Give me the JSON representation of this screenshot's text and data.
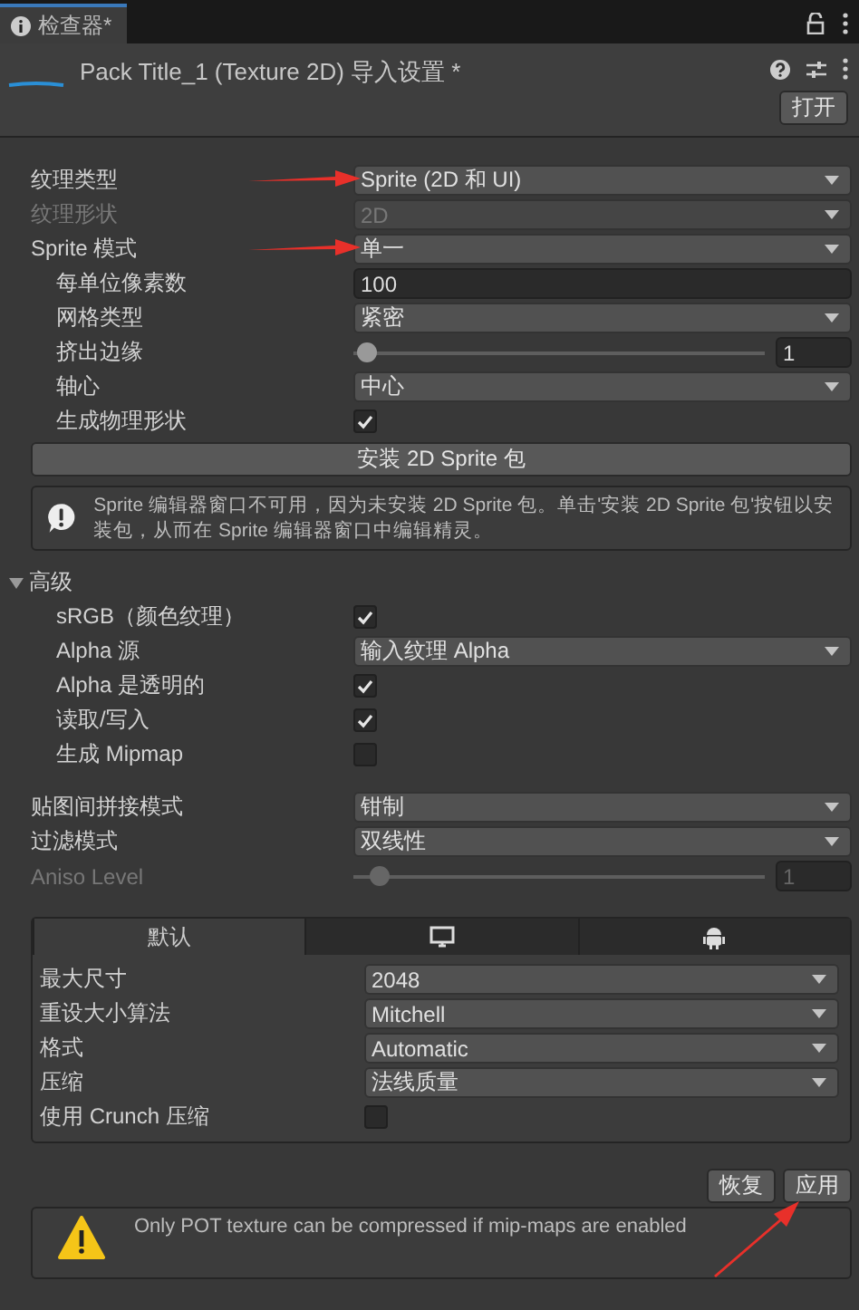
{
  "tab": {
    "label": "检查器*",
    "selected": true
  },
  "header": {
    "title": "Pack Title_1 (Texture 2D) 导入设置 *",
    "open_button": "打开"
  },
  "rows": [
    {
      "kind": "dropdown",
      "label": "纹理类型",
      "value": "Sprite (2D 和 UI)",
      "disabled": false,
      "arrow": true
    },
    {
      "kind": "dropdown",
      "label": "纹理形状",
      "value": "2D",
      "disabled": true
    },
    {
      "kind": "dropdown",
      "label": "Sprite 模式",
      "value": "单一",
      "disabled": false,
      "arrow": true,
      "children": [
        {
          "kind": "field",
          "label": "每单位像素数",
          "value": "100"
        },
        {
          "kind": "dropdown",
          "label": "网格类型",
          "value": "紧密",
          "disabled": false
        },
        {
          "kind": "slider",
          "label": "挤出边缘",
          "level": 0.03,
          "value": "1",
          "disabled": false
        },
        {
          "kind": "dropdown",
          "label": "轴心",
          "value": "中心",
          "disabled": false
        },
        {
          "kind": "checkbox",
          "label": "生成物理形状",
          "checked": true
        }
      ]
    },
    {
      "kind": "button",
      "label": "安装 2D Sprite 包"
    },
    {
      "kind": "help",
      "text": "Sprite 编辑器窗口不可用，因为未安装 2D Sprite 包。单击'安装 2D Sprite 包'按钮以安装包，从而在 Sprite 编辑器窗口中编辑精灵。"
    },
    {
      "kind": "foldout",
      "label": "高级",
      "expanded": true,
      "children": [
        {
          "kind": "checkbox",
          "label": "sRGB（颜色纹理）",
          "checked": true
        },
        {
          "kind": "dropdown",
          "label": "Alpha 源",
          "value": "输入纹理 Alpha",
          "disabled": false
        },
        {
          "kind": "checkbox",
          "label": "Alpha 是透明的",
          "checked": true
        },
        {
          "kind": "checkbox",
          "label": "读取/写入",
          "checked": true
        },
        {
          "kind": "checkbox",
          "label": "生成 Mipmap",
          "checked": false
        }
      ]
    },
    {
      "kind": "dropdown",
      "label": "贴图间拼接模式",
      "value": "钳制",
      "disabled": false
    },
    {
      "kind": "dropdown",
      "label": "过滤模式",
      "value": "双线性",
      "disabled": false
    },
    {
      "kind": "slider",
      "label": "Aniso Level",
      "level": 0.06,
      "value": "1",
      "disabled": true
    }
  ],
  "platform": {
    "tabs": [
      {
        "kind": "text",
        "label": "默认",
        "selected": true
      },
      {
        "kind": "monitor",
        "selected": false
      },
      {
        "kind": "android",
        "selected": false
      }
    ],
    "rows": [
      {
        "kind": "dropdown",
        "label": "最大尺寸",
        "value": "2048",
        "disabled": false
      },
      {
        "kind": "dropdown",
        "label": "重设大小算法",
        "value": "Mitchell",
        "disabled": false
      },
      {
        "kind": "dropdown",
        "label": "格式",
        "value": "Automatic",
        "disabled": false
      },
      {
        "kind": "dropdown",
        "label": "压缩",
        "value": "法线质量",
        "disabled": false
      },
      {
        "kind": "checkbox",
        "label": "使用 Crunch 压缩",
        "checked": false
      }
    ]
  },
  "buttons": [
    {
      "label": "恢复"
    },
    {
      "label": "应用",
      "arrow": true
    }
  ],
  "warning": "Only POT texture can be compressed if mip-maps are enabled"
}
